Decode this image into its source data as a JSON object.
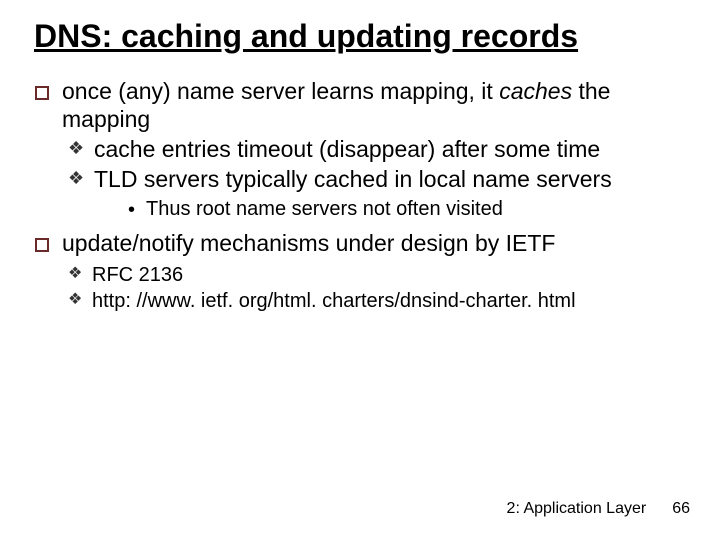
{
  "title": "DNS: caching and updating records",
  "bullets": {
    "b1_pre": "once (any) name server learns mapping, it ",
    "b1_em": "caches",
    "b1_post": " the mapping",
    "b1_s1": "cache entries timeout (disappear) after some time",
    "b1_s2": "TLD servers typically cached in local name servers",
    "b1_s2_a": "Thus root name servers not often visited",
    "b2": "update/notify mechanisms under design by IETF",
    "b2_s1": "RFC 2136",
    "b2_s2": "http: //www. ietf. org/html. charters/dnsind-charter. html"
  },
  "footer": {
    "chapter": "2: Application Layer",
    "page": "66"
  }
}
